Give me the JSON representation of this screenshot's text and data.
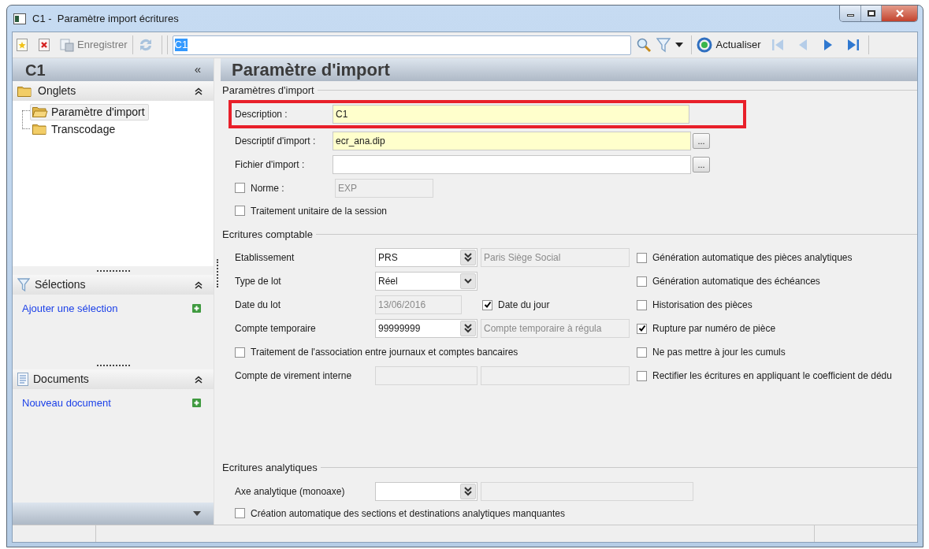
{
  "window": {
    "title": "C1 -  Paramètre import écritures"
  },
  "toolbar": {
    "save": {
      "label": "Enregistrer",
      "disabled": true
    },
    "search": {
      "value": "C1",
      "highlighted": true
    },
    "refresh": {
      "label": "Actualiser"
    },
    "nav": [
      {
        "kind": "first",
        "disabled": true
      },
      {
        "kind": "previous",
        "disabled": true
      },
      {
        "kind": "next",
        "disabled": false
      },
      {
        "kind": "last",
        "disabled": false
      }
    ]
  },
  "sidebar": {
    "title": "C1",
    "collapse": "«",
    "panels": [
      {
        "kind": "tabs",
        "title": "Onglets",
        "items": [
          {
            "label": "Paramètre d'import",
            "selected": true
          },
          {
            "label": "Transcodage",
            "selected": false
          }
        ]
      },
      {
        "kind": "selections",
        "title": "Sélections",
        "link": "Ajouter une sélection"
      },
      {
        "kind": "documents",
        "title": "Documents",
        "link": "Nouveau document"
      }
    ]
  },
  "main": {
    "title": "Paramètre d'import",
    "import": {
      "legend": "Paramètres d'import",
      "description": {
        "label": "Description :",
        "value": "C1",
        "required": true,
        "highlighted": true
      },
      "descriptif": {
        "label": "Descriptif d'import :",
        "value": "ecr_ana.dip",
        "required": true,
        "browse": "..."
      },
      "fichier": {
        "label": "Fichier d'import :",
        "required": false,
        "browse": "..."
      },
      "norme": {
        "label": "Norme :",
        "checked": false,
        "value": "EXP",
        "disabled": true
      },
      "unitaire": {
        "label": "Traitement unitaire de la session",
        "checked": false
      }
    },
    "comptable": {
      "legend": "Ecritures comptable",
      "etablissement": {
        "label": "Etablissement",
        "value": "PRS",
        "kind": "lookup",
        "description": "Paris Siège Social"
      },
      "type_lot": {
        "label": "Type de lot",
        "value": "Réel",
        "kind": "dropdown"
      },
      "date_lot": {
        "label": "Date du lot",
        "value": "13/06/2016",
        "disabled": true
      },
      "date_du_jour": {
        "label": "Date du jour",
        "checked": true
      },
      "compte_temporaire": {
        "label": "Compte temporaire",
        "value": "99999999",
        "kind": "lookup",
        "description": "Compte temporaire à régula"
      },
      "association": {
        "label": "Traitement de l'association entre journaux et comptes bancaires",
        "checked": false
      },
      "virement": {
        "label": "Compte de virement interne"
      },
      "options": [
        {
          "label": "Génération automatique des pièces analytiques",
          "checked": false
        },
        {
          "label": "Génération automatique des échéances",
          "checked": false
        },
        {
          "label": "Historisation des pièces",
          "checked": false
        },
        {
          "label": "Rupture par numéro de pièce",
          "checked": true
        },
        {
          "label": "Ne pas mettre à jour les cumuls",
          "checked": false
        },
        {
          "label": "Rectifier les écritures en appliquant le coefficient de dédu",
          "checked": false
        }
      ]
    },
    "analytique": {
      "legend": "Ecritures analytiques",
      "axe": {
        "label": "Axe analytique (monoaxe)",
        "kind": "lookup"
      },
      "creation": {
        "label": "Création automatique des sections et destinations analytiques manquantes",
        "checked": false
      }
    }
  }
}
